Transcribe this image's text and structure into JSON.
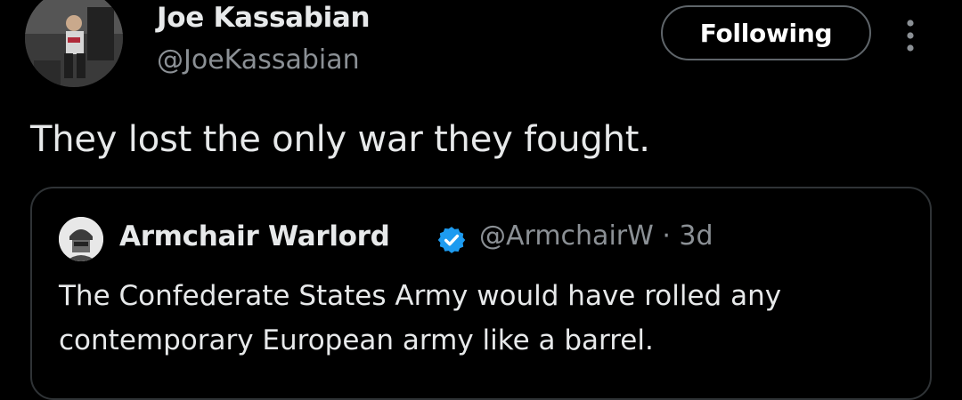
{
  "author": {
    "display_name": "Joe Kassabian",
    "handle": "@JoeKassabian",
    "avatar": "profile-photo"
  },
  "follow_button": {
    "label": "Following"
  },
  "more_menu": {
    "icon": "more-vertical-icon"
  },
  "tweet": {
    "text": "They lost the only war they fought."
  },
  "quoted_tweet": {
    "display_name": "Armchair Warlord",
    "verified": true,
    "verified_color": "#1d9bf0",
    "handle": "@ArmchairW",
    "separator": "·",
    "time": "3d",
    "text": "The Confederate States Army would have rolled any contemporary European army like a barrel."
  },
  "colors": {
    "background": "#000000",
    "primary_text": "#e7e9ea",
    "secondary_text": "#8b9095",
    "border": "#2f3336"
  }
}
